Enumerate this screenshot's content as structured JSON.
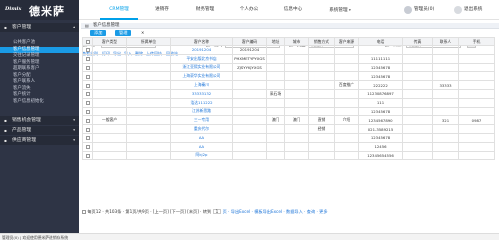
{
  "logo": {
    "en": "Dimix",
    "cn": "德米萨"
  },
  "topnav": {
    "items": [
      {
        "label": "CRM管理",
        "active": true
      },
      {
        "label": "进销存",
        "active": false
      },
      {
        "label": "财务管理",
        "active": false
      },
      {
        "label": "个人办公",
        "active": false
      },
      {
        "label": "信息中心",
        "active": false
      },
      {
        "label": "系统管理",
        "active": false,
        "caret": "▾"
      }
    ],
    "user_label": "管理员(0)",
    "logout_label": "退出系统"
  },
  "sidebar": {
    "sections": [
      {
        "label": "客户管理",
        "icon": "▪",
        "arrow": "▴"
      },
      {
        "label": "销售机会管理",
        "icon": "▪",
        "arrow": "▾"
      },
      {
        "label": "产品管理",
        "icon": "▪",
        "arrow": "▾"
      },
      {
        "label": "供应商管理",
        "icon": "▪",
        "arrow": "▾"
      }
    ],
    "items": [
      {
        "label": "公共客户池",
        "active": false
      },
      {
        "label": "客户信息管理",
        "active": true
      },
      {
        "label": "交往记录管理",
        "active": false
      },
      {
        "label": "客户服务管理",
        "active": false
      },
      {
        "label": "超期联系客户",
        "active": false
      },
      {
        "label": "客户分配",
        "active": false
      },
      {
        "label": "客户联系人",
        "active": false
      },
      {
        "label": "客户流失",
        "active": false
      },
      {
        "label": "客户统计",
        "active": false
      },
      {
        "label": "客户信息初始化",
        "active": false
      }
    ]
  },
  "panel": {
    "title": "客户信息管理",
    "buttons": {
      "add": "添加",
      "manage": "管理"
    }
  },
  "filters": {
    "name_label": "客户名:",
    "code_label": "客户编码:",
    "type_label": "客户类型:",
    "type_value": "请选择",
    "source_label": "客户来源:",
    "source_value": "请选择",
    "search_icon": "magnifier-icon"
  },
  "tools": [
    "查看全列",
    "打印",
    "导出",
    "导入",
    "删除",
    "上传回执",
    "回收站"
  ],
  "table": {
    "headers": [
      "",
      "客户类型",
      "所属单位",
      "客户名称",
      "客户编码",
      "地址",
      "城市",
      "销售方式",
      "客户来源",
      "电话",
      "传真",
      "联系人",
      "手机"
    ],
    "rows": [
      [
        "",
        "",
        "",
        "20191204",
        "20191204",
        "",
        "",
        "",
        "",
        "",
        "",
        "",
        ""
      ],
      [
        "",
        "",
        "",
        "平安出版北京书店",
        "PHXMETYPYXGS",
        "",
        "",
        "",
        "",
        "11111111",
        "",
        "",
        ""
      ],
      [
        "",
        "",
        "",
        "浙江亚熙实业有限公司",
        "ZJSYYKJYXGS",
        "",
        "",
        "",
        "",
        "12345678",
        "",
        "",
        ""
      ],
      [
        "",
        "",
        "",
        "上海豪华实业有限公司",
        "",
        "",
        "",
        "",
        "",
        "12345678",
        "",
        "",
        ""
      ],
      [
        "",
        "",
        "",
        "上海秦川",
        "",
        "",
        "",
        "",
        "百度推广",
        "222222",
        "",
        "33333",
        ""
      ],
      [
        "",
        "",
        "",
        "33333132",
        "",
        "采石场",
        "",
        "",
        "",
        "11230876897",
        "",
        "",
        ""
      ],
      [
        "",
        "",
        "",
        "浩达111222",
        "",
        "",
        "",
        "",
        "",
        "111",
        "",
        "",
        ""
      ],
      [
        "",
        "",
        "",
        "江苏新思路",
        "",
        "",
        "",
        "",
        "",
        "12345678",
        "",
        "",
        ""
      ],
      [
        "",
        "一般客户",
        "",
        "三一专用",
        "",
        "澳门",
        "澳门",
        "直销",
        "介绍",
        "1234567890",
        "",
        "321",
        "0987"
      ],
      [
        "",
        "",
        "",
        "重庆代尔",
        "",
        "",
        "",
        "经销",
        "",
        "021-3589215",
        "",
        "",
        ""
      ],
      [
        "",
        "",
        "",
        "AA",
        "",
        "",
        "",
        "",
        "",
        "12345678",
        "",
        "",
        ""
      ],
      [
        "",
        "",
        "",
        "AA",
        "",
        "",
        "",
        "",
        "",
        "12456",
        "",
        "",
        ""
      ],
      [
        "",
        "",
        "",
        "阿kj2p",
        "",
        "",
        "",
        "",
        "",
        "12345654556",
        "",
        "",
        ""
      ]
    ]
  },
  "pager": {
    "summary": "每页12 · 共103条 · 第1页/共9页 · [上一页] [下一页] [末页] · 转到",
    "page_size": "1",
    "after": "页 · 导出Excel · 模板导出Excel · 数据导入 · 查询 · 更多"
  },
  "footer": "管理员(0) | 欢迎使用德米萨进销存系统"
}
